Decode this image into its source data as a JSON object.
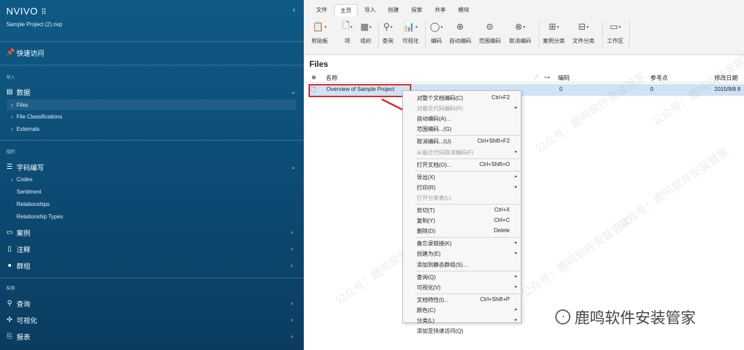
{
  "sidebar": {
    "brand": "NVIVO",
    "brand_dots": "⠿",
    "project": "Sample Project (2).nvp",
    "collapse": "‹",
    "quick_access": "快速访问",
    "sections": {
      "import": "导入",
      "organize": "组织",
      "explore": "探索"
    },
    "data": "数据",
    "data_items": [
      "Files",
      "File Classifications",
      "Externals"
    ],
    "coding": "字码编写",
    "coding_items": [
      "Codes",
      "Sentiment",
      "Relationships",
      "Relationship Types"
    ],
    "cases": "案例",
    "notes": "注释",
    "sets": "群组",
    "query": "查询",
    "visualize": "可视化",
    "reports": "报表"
  },
  "ribbon": {
    "tabs": [
      "文件",
      "主页",
      "导入",
      "创建",
      "探索",
      "共享",
      "模块"
    ],
    "active_tab": "主页",
    "tools": [
      "剪贴板",
      "项",
      "组织",
      "查询",
      "可视化",
      "编码",
      "自动编码",
      "范围编码",
      "取消编码",
      "案例分类",
      "文件分类",
      "工作区"
    ]
  },
  "main": {
    "title": "Files",
    "columns": {
      "name": "名称",
      "codes": "编码",
      "refs": "参考点",
      "modified": "修改日期"
    },
    "row": {
      "name": "Overview of Sample Project",
      "codes": "0",
      "refs": "0",
      "modified": "2015/9/8 8"
    }
  },
  "context_menu": [
    {
      "label": "对整个文档编码(C)",
      "shortcut": "Ctrl+F2"
    },
    {
      "label": "对最近代码编码(R)",
      "submenu": true,
      "disabled": true
    },
    {
      "label": "自动编码(A)..."
    },
    {
      "label": "范围编码...(G)"
    },
    {
      "label": "取消编码...(U)",
      "shortcut": "Ctrl+Shift+F2"
    },
    {
      "label": "从最近代码取消编码(F)",
      "submenu": true,
      "disabled": true
    },
    {
      "label": "打开文档(O)...",
      "shortcut": "Ctrl+Shift+O"
    },
    {
      "label": "导出(X)",
      "submenu": true
    },
    {
      "label": "打印(R)",
      "submenu": true
    },
    {
      "label": "打开分类表(L)",
      "disabled": true
    },
    {
      "label": "剪切(T)",
      "shortcut": "Ctrl+X"
    },
    {
      "label": "复制(Y)",
      "shortcut": "Ctrl+C"
    },
    {
      "label": "删除(D)",
      "shortcut": "Delete"
    },
    {
      "label": "备忘录链接(K)",
      "submenu": true
    },
    {
      "label": "创建为(E)",
      "submenu": true
    },
    {
      "label": "添加到静态群组(S)..."
    },
    {
      "label": "查询(Q)",
      "submenu": true
    },
    {
      "label": "可视化(V)",
      "submenu": true
    },
    {
      "label": "文档特性(I)...",
      "shortcut": "Ctrl+Shift+P"
    },
    {
      "label": "颜色(C)",
      "submenu": true
    },
    {
      "label": "分类(L)",
      "submenu": true
    },
    {
      "label": "添加至快速访问(Q)"
    }
  ],
  "watermark": {
    "text": "公众号：鹿鸣软件安装管家",
    "brand": "鹿鸣软件安装管家"
  },
  "colors": {
    "sidebar": "#0e5a86",
    "selection": "#cfe3f5",
    "highlight": "#e02424"
  }
}
